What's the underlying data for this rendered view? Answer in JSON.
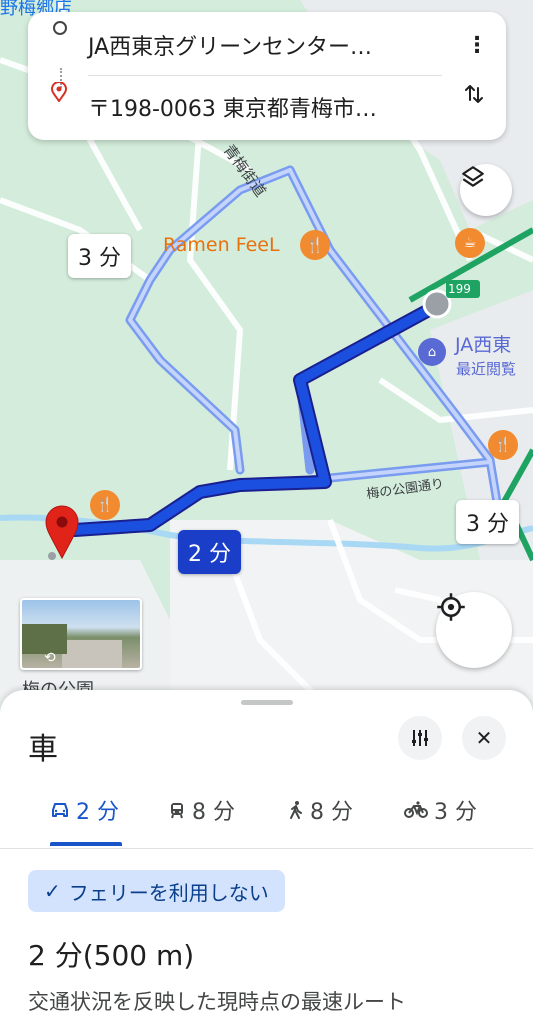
{
  "route": {
    "origin": "JA西東京グリーンセンター…",
    "destination": "〒198-0063 東京都青梅市…"
  },
  "map": {
    "labels": {
      "top_left": "野梅郷店",
      "ramen": "Ramen FeeL",
      "road_ome_kaido": "青梅街道",
      "road_ume_park": "梅の公園通り",
      "ja_label": "JA西東",
      "recent": "最近閲覧",
      "route_badge": "199",
      "ume_park": "梅の公園"
    },
    "time_chips": {
      "alt_left": "3 分",
      "main": "2 分",
      "alt_right": "3 分"
    }
  },
  "sheet": {
    "mode": "車",
    "tabs": [
      {
        "icon": "car-icon",
        "label": "2 分"
      },
      {
        "icon": "transit-icon",
        "label": "8 分"
      },
      {
        "icon": "walk-icon",
        "label": "8 分"
      },
      {
        "icon": "bike-icon",
        "label": "3 分"
      }
    ],
    "option_chip": "フェリーを利用しない",
    "duration": "2 分",
    "distance": "(500 m)",
    "description": "交通状況を反映した現時点の最速ルート"
  },
  "colors": {
    "route_main": "#1a4fe0",
    "route_alt": "#7a9cf0",
    "accent": "#1a55c9"
  }
}
